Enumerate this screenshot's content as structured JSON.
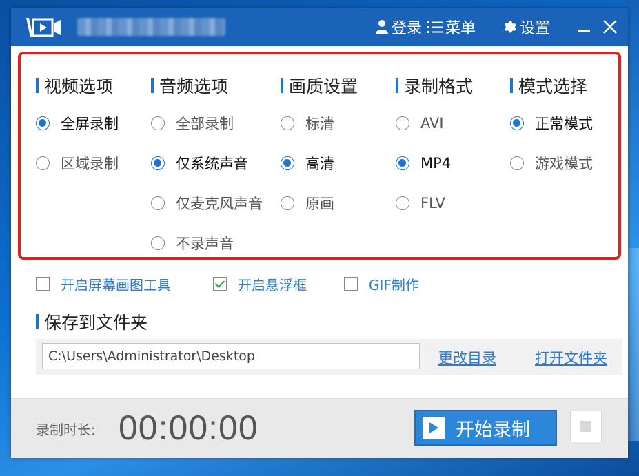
{
  "titlebar": {
    "app_title": "",
    "login_label": "登录",
    "menu_label": "菜单",
    "settings_label": "设置"
  },
  "columns": [
    {
      "header": "视频选项",
      "options": [
        {
          "label": "全屏录制",
          "checked": true
        },
        {
          "label": "区域录制",
          "checked": false
        }
      ]
    },
    {
      "header": "音频选项",
      "options": [
        {
          "label": "全部录制",
          "checked": false
        },
        {
          "label": "仅系统声音",
          "checked": true
        },
        {
          "label": "仅麦克风声音",
          "checked": false
        },
        {
          "label": "不录声音",
          "checked": false
        }
      ]
    },
    {
      "header": "画质设置",
      "options": [
        {
          "label": "标清",
          "checked": false
        },
        {
          "label": "高清",
          "checked": true
        },
        {
          "label": "原画",
          "checked": false
        }
      ]
    },
    {
      "header": "录制格式",
      "options": [
        {
          "label": "AVI",
          "checked": false
        },
        {
          "label": "MP4",
          "checked": true
        },
        {
          "label": "FLV",
          "checked": false
        }
      ]
    },
    {
      "header": "模式选择",
      "options": [
        {
          "label": "正常模式",
          "checked": true
        },
        {
          "label": "游戏模式",
          "checked": false
        }
      ]
    }
  ],
  "checkboxes": [
    {
      "label": "开启屏幕画图工具",
      "checked": false
    },
    {
      "label": "开启悬浮框",
      "checked": true
    },
    {
      "label": "GIF制作",
      "checked": false
    }
  ],
  "folder": {
    "header": "保存到文件夹",
    "path": "C:\\Users\\Administrator\\Desktop",
    "change_label": "更改目录",
    "open_label": "打开文件夹"
  },
  "footer": {
    "duration_label": "录制时长:",
    "duration_value": "00:00:00",
    "start_label": "开始录制"
  },
  "colors": {
    "accent": "#1e74d2",
    "titlebar": "#1a63b8",
    "highlight_border": "#e32119",
    "link": "#2a7dd6"
  }
}
